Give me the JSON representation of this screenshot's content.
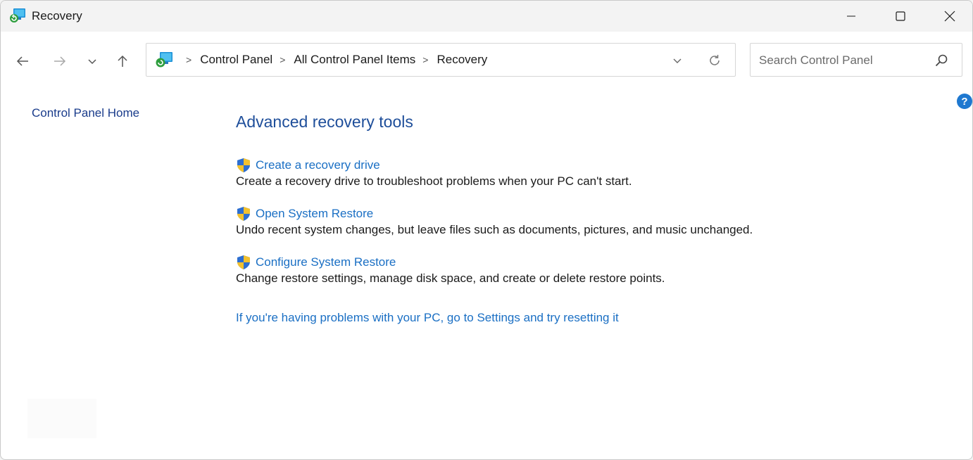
{
  "window": {
    "title": "Recovery"
  },
  "address_bar": {
    "breadcrumbs": [
      "Control Panel",
      "All Control Panel Items",
      "Recovery"
    ],
    "separator": ">"
  },
  "search": {
    "placeholder": "Search Control Panel"
  },
  "sidebar": {
    "home_link": "Control Panel Home"
  },
  "main": {
    "heading": "Advanced recovery tools",
    "tasks": [
      {
        "link": "Create a recovery drive",
        "description": "Create a recovery drive to troubleshoot problems when your PC can't start.",
        "icon": "uac-shield-icon"
      },
      {
        "link": "Open System Restore",
        "description": "Undo recent system changes, but leave files such as documents, pictures, and music unchanged.",
        "icon": "uac-shield-icon"
      },
      {
        "link": "Configure System Restore",
        "description": "Change restore settings, manage disk space, and create or delete restore points.",
        "icon": "uac-shield-icon"
      }
    ],
    "reset_link": "If you're having problems with your PC, go to Settings and try resetting it"
  },
  "colors": {
    "link_blue": "#1a6fc4",
    "heading_blue": "#1e4e9a",
    "sidebar_link": "#1a3c8b",
    "titlebar_bg": "#f3f3f3"
  }
}
